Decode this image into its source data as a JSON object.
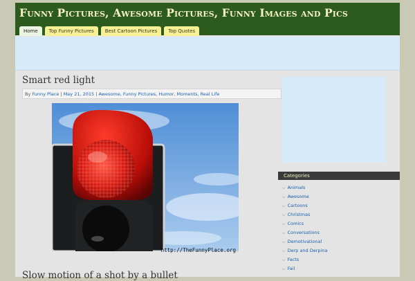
{
  "site": {
    "title": "Funny Pictures, Awesome Pictures, Funny Images and Pics"
  },
  "nav": {
    "tabs": [
      {
        "label": "Home",
        "active": true
      },
      {
        "label": "Top Funny Pictures",
        "active": false
      },
      {
        "label": "Best Cartoon Pictures",
        "active": false
      },
      {
        "label": "Top Quotes",
        "active": false
      }
    ]
  },
  "post": {
    "title": "Smart red light",
    "meta": {
      "by": "By",
      "author": "Funny Place",
      "sep": "|",
      "date": "May 21, 2015",
      "categories": [
        "Awesome",
        "Funny Pictures",
        "Humor",
        "Moments",
        "Real Life"
      ]
    },
    "image_watermark": "http://TheFunnyPlace.org"
  },
  "next_post": {
    "title": "Slow motion of a shot by a bullet"
  },
  "sidebar": {
    "categories_heading": "Categories",
    "categories": [
      "Animals",
      "Awesome",
      "Cartoons",
      "Christmas",
      "Comics",
      "Conversations",
      "Demotivational",
      "Derp and Derpina",
      "Facts",
      "Fail"
    ]
  },
  "colors": {
    "header_bg": "#2d5a1d",
    "title_text": "#f4f3c4",
    "tab_bg": "#f8f094",
    "link": "#1a5fb0",
    "banner": "#d7eafa"
  }
}
